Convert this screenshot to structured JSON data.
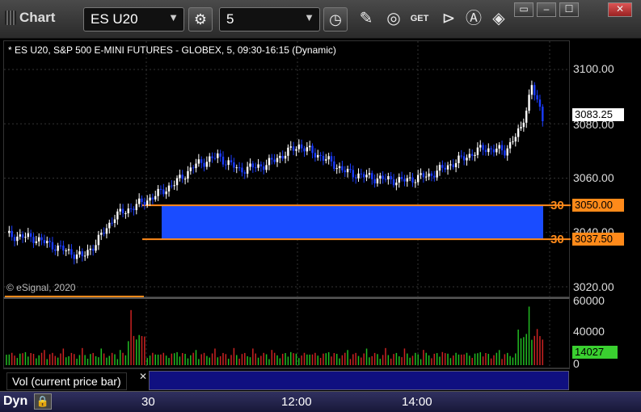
{
  "window": {
    "title": "Chart",
    "symbol": "ES U20",
    "interval": "5",
    "restore_label": "▭",
    "minimize_label": "‒",
    "maximize_label": "☐",
    "close_label": "✕"
  },
  "toolbar": {
    "icons": [
      "settings-gear-icon",
      "clock-icon",
      "pencil-draw-icon",
      "studies-icon",
      "get-data-icon",
      "play-icon",
      "alerts-icon",
      "shapes-icon"
    ]
  },
  "chart": {
    "symbol_info": "* ES U20, S&P 500 E-MINI FUTURES - GLOBEX, 5, 09:30-16:15 (Dynamic)",
    "copyright": "© eSignal, 2020",
    "price_labels": [
      "3100.00",
      "3080.00",
      "3060.00",
      "3040.00",
      "3020.00"
    ],
    "last_price": "3083.25",
    "upper_level": "3050.00",
    "lower_level": "3037.50",
    "side_upper": "30",
    "side_lower": "30",
    "colors": {
      "up": "#ffffff",
      "down": "#1a3cff",
      "zone": "#1a4cff",
      "level": "#ff8a1a",
      "vol_up": "#22bb22",
      "vol_down": "#cc2222"
    }
  },
  "volume": {
    "labels": [
      "60000",
      "40000",
      "0"
    ],
    "current": "14027",
    "study_label": "Vol (current price bar)",
    "close_label": "✕"
  },
  "time_axis": {
    "mode": "Dyn",
    "lock_label": "🔒",
    "labels": [
      "30",
      "12:00",
      "14:00"
    ]
  }
}
